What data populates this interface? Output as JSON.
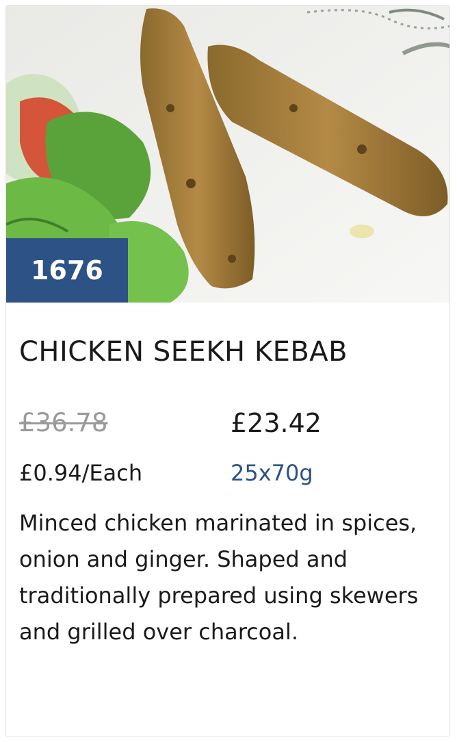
{
  "product": {
    "code": "1676",
    "title": "CHICKEN SEEKH KEBAB",
    "old_price": "£36.78",
    "price": "£23.42",
    "unit_price": "£0.94/Each",
    "pack_size": "25x70g",
    "description": "Minced chicken marinated in spices, onion and ginger. Shaped and traditionally prepared using skewers and grilled over charcoal."
  },
  "colors": {
    "badge": "#2c5286",
    "pack_size_text": "#2c5286",
    "old_price_text": "#9a9a9a"
  },
  "image": {
    "subject": "chicken-seekh-kebab-photo"
  }
}
